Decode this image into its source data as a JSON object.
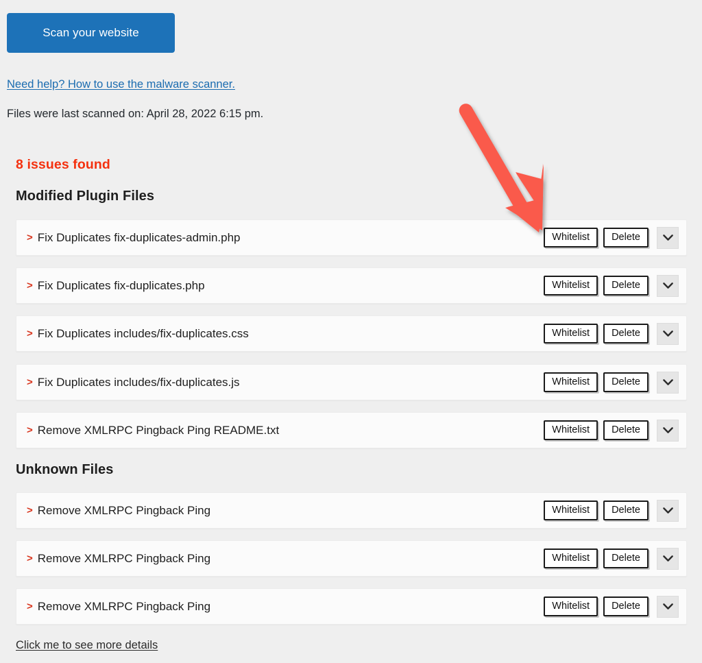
{
  "primary_button": {
    "label": "Scan your website",
    "color": "#1d72b8"
  },
  "help_link": {
    "label": "Need help? How to use the malware scanner.",
    "color": "#1b6cb0"
  },
  "last_scanned": {
    "text": "Files were last scanned on: April 28, 2022 6:15 pm."
  },
  "issues_summary": {
    "label": "8 issues found",
    "count": 8,
    "color": "#f4310f"
  },
  "annotation": {
    "type": "arrow",
    "color": "#fa5a4b",
    "points_to": "whitelist-button-row-0"
  },
  "row_actions": {
    "whitelist_label": "Whitelist",
    "delete_label": "Delete",
    "expand_icon": "chevron-down-icon"
  },
  "sections": [
    {
      "heading": "Modified Plugin Files",
      "rows": [
        {
          "caret": ">",
          "name": "Fix Duplicates fix-duplicates-admin.php"
        },
        {
          "caret": ">",
          "name": "Fix Duplicates fix-duplicates.php"
        },
        {
          "caret": ">",
          "name": "Fix Duplicates includes/fix-duplicates.css"
        },
        {
          "caret": ">",
          "name": "Fix Duplicates includes/fix-duplicates.js"
        },
        {
          "caret": ">",
          "name": "Remove XMLRPC Pingback Ping README.txt"
        }
      ]
    },
    {
      "heading": "Unknown Files",
      "rows": [
        {
          "caret": ">",
          "name": "Remove XMLRPC Pingback Ping"
        },
        {
          "caret": ">",
          "name": "Remove XMLRPC Pingback Ping"
        },
        {
          "caret": ">",
          "name": "Remove XMLRPC Pingback Ping"
        }
      ]
    }
  ],
  "footer_link": {
    "label": "Click me to see more details"
  }
}
